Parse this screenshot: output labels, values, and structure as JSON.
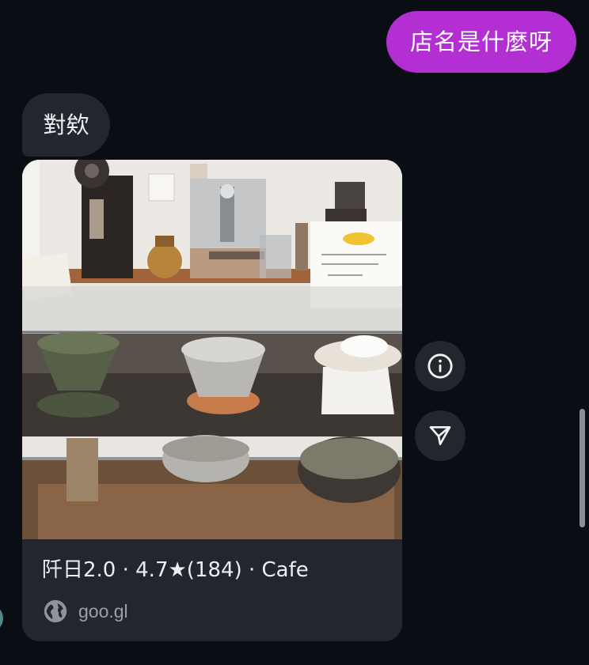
{
  "messages": {
    "outgoing": {
      "text": "店名是什麼呀",
      "color": "#b32fd3"
    },
    "incoming": {
      "text": "對欸"
    }
  },
  "place_card": {
    "title": "阡日2.0 · 4.7★(184) · Cafe",
    "link_text": "goo.gl",
    "link_icon": "globe-icon",
    "photo": "cafe-counter-photo"
  },
  "actions": {
    "info_icon": "info-icon",
    "share_icon": "send-icon"
  },
  "colors": {
    "background": "#0a0d13",
    "bubble_incoming": "#23262d",
    "text_primary": "#eceef2",
    "text_secondary": "#9aa0aa"
  }
}
